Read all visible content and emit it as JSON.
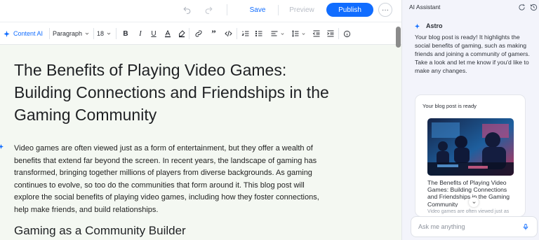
{
  "header": {
    "save_label": "Save",
    "preview_label": "Preview",
    "publish_label": "Publish",
    "more_label": "···"
  },
  "toolbar": {
    "content_ai_label": "Content AI",
    "paragraph_label": "Paragraph",
    "font_size": "18"
  },
  "editor": {
    "title": "The Benefits of Playing Video Games: Building Connections and Friendships in the Gaming Community",
    "paragraph": "Video games are often viewed just as a form of entertainment, but they offer a wealth of benefits that extend far beyond the screen. In recent years, the landscape of gaming has transformed, bringing together millions of players from diverse backgrounds. As gaming continues to evolve, so too do the communities that form around it. This blog post will explore the social benefits of playing video games, including how they foster connections, help make friends, and build relationships.",
    "subheading": "Gaming as a Community Builder"
  },
  "assistant": {
    "panel_title": "AI Assistant",
    "astro_name": "Astro",
    "message": "Your blog post is ready! It highlights the social benefits of gaming, such as making friends and joining a community of gamers. Take a look and let me know if you'd like to make any changes.",
    "card_label": "Your blog post is ready",
    "card_title": "The Benefits of Playing Video Games: Building Connections and Friendships in the Gaming Community",
    "card_excerpt": "Video games are often viewed just as",
    "input_placeholder": "Ask me anything"
  },
  "colors": {
    "accent": "#116dff",
    "editor_bg": "#f4f8f2",
    "panel_bg": "#f3f4fb"
  }
}
